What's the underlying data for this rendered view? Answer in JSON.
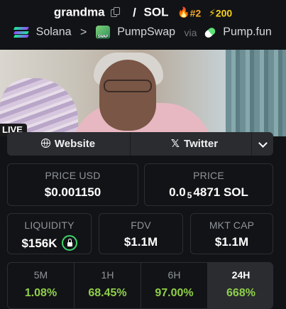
{
  "header": {
    "token_symbol": "grandma",
    "separator": "/",
    "quote_symbol": "SOL",
    "rank": "#2",
    "boost": "200",
    "chain": "Solana",
    "dex": "PumpSwap",
    "via_label": "via",
    "launchpad": "Pump.fun",
    "icons": [
      "copy-icon",
      "flame-icon",
      "lightning-icon",
      "solana-icon",
      "chevron-right-icon",
      "pumpswap-icon",
      "pill-icon"
    ]
  },
  "banner": {
    "live_label": "LIVE"
  },
  "links": {
    "website": "Website",
    "twitter": "Twitter"
  },
  "stats": {
    "price_usd_label": "PRICE USD",
    "price_usd": "$0.001150",
    "price_label": "PRICE",
    "price_prefix": "0.0",
    "price_subscript": "5",
    "price_digits": "4871 SOL",
    "liquidity_label": "LIQUIDITY",
    "liquidity": "$156K",
    "fdv_label": "FDV",
    "fdv": "$1.1M",
    "mkt_cap_label": "MKT CAP",
    "mkt_cap": "$1.1M"
  },
  "timeframes": [
    {
      "label": "5M",
      "change": "1.08%"
    },
    {
      "label": "1H",
      "change": "68.45%"
    },
    {
      "label": "6H",
      "change": "97.00%"
    },
    {
      "label": "24H",
      "change": "668%"
    }
  ],
  "colors": {
    "background": "#121316",
    "positive": "#8fcf4a",
    "rank": "#f7a928",
    "boost": "#f6d21e",
    "lock_ring": "#3ed46a"
  }
}
